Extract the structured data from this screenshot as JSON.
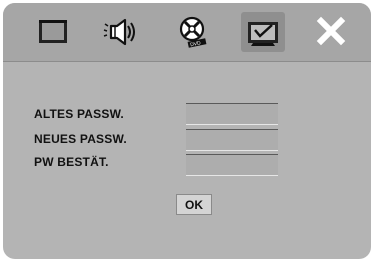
{
  "menu": {
    "tabs": [
      {
        "icon": "display-icon"
      },
      {
        "icon": "speaker-icon"
      },
      {
        "icon": "disc-icon"
      },
      {
        "icon": "preferences-icon",
        "selected": true
      },
      {
        "icon": "close-icon"
      }
    ]
  },
  "password_form": {
    "old_password_label": "ALTES PASSW.",
    "new_password_label": "NEUES PASSW.",
    "confirm_password_label": "PW BESTÄT.",
    "old_password_value": "",
    "new_password_value": "",
    "confirm_password_value": "",
    "ok_label": "OK"
  },
  "colors": {
    "background": "#b4b4b4",
    "menubar": "#a6a6a6",
    "field": "#adadad",
    "button": "#d4d4d4"
  }
}
